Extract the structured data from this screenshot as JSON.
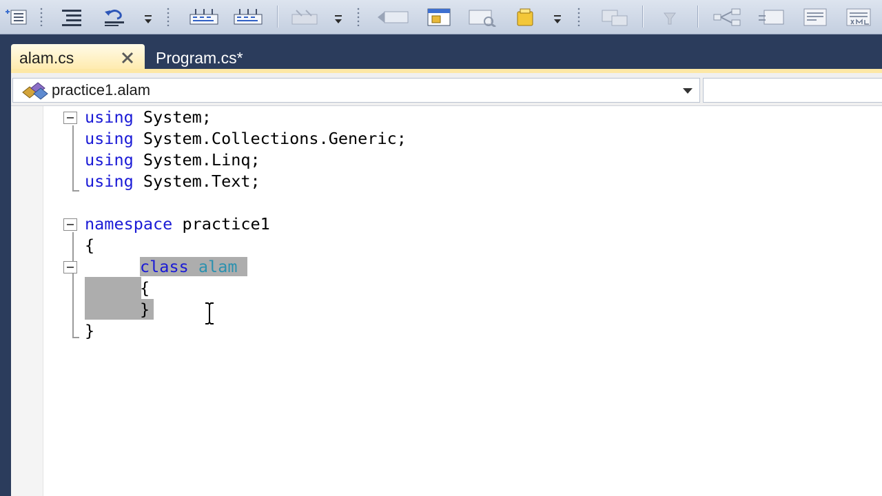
{
  "colors": {
    "toolbar_bg": "#d3dbe8",
    "chrome_bg": "#2b3c5c",
    "active_tab_bg": "#ffefb8",
    "editor_bg": "#ffffff",
    "keyword": "#1a1ad6",
    "type_name": "#2b91af",
    "selection": "#adadad"
  },
  "toolbar": {
    "icons": [
      "outline-icon",
      "format-indent-icon",
      "undo-comment-icon",
      "dropdown-arrow-icon",
      "bookmark-icon",
      "bookmark-next-icon",
      "bookmark-disabled-icon",
      "dropdown-arrow-icon",
      "navigate-back-icon",
      "properties-icon",
      "object-browser-icon",
      "toolbox-icon",
      "dropdown-arrow-icon",
      "server-explorer-icon",
      "filter-icon",
      "diagram-icon",
      "class-view-icon",
      "resource-icon",
      "xml-icon"
    ]
  },
  "tabs": {
    "active": {
      "label": "alam.cs",
      "close_icon": "close-icon"
    },
    "inactive": {
      "label": "Program.cs*"
    }
  },
  "navbar": {
    "type_selector": "practice1.alam",
    "type_icon": "class-icon",
    "member_selector": ""
  },
  "editor": {
    "lines": {
      "l1_kw": "using",
      "l1_rest": " System;",
      "l2_kw": "using",
      "l2_rest": " System.Collections.Generic;",
      "l3_kw": "using",
      "l3_rest": " System.Linq;",
      "l4_kw": "using",
      "l4_rest": " System.Text;",
      "l6_kw": "namespace",
      "l6_rest": " practice1",
      "l7_text": "{",
      "l8_kw": "class",
      "l8_type": "alam",
      "l9_text": "{",
      "l10_text": "}",
      "l11_text": "}"
    }
  }
}
